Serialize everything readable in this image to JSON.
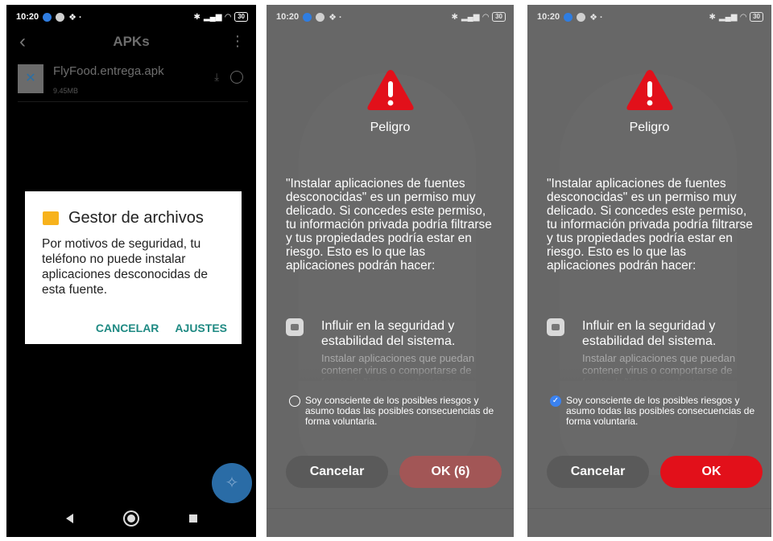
{
  "status_bar": {
    "time": "10:20",
    "battery": "30"
  },
  "screen1": {
    "app_title": "APKs",
    "file": {
      "name": "FlyFood.entrega.apk",
      "size": "9.45MB"
    },
    "dialog": {
      "title": "Gestor de archivos",
      "body": "Por motivos de seguridad, tu teléfono no puede instalar aplicaciones desconocidas de esta fuente.",
      "cancel": "CANCELAR",
      "settings": "AJUSTES"
    }
  },
  "screen2": {
    "title": "Peligro",
    "body": "\"Instalar aplicaciones de fuentes desconocidas\" es un permiso muy delicado. Si concedes este permiso, tu información privada podría filtrarse y tus propiedades podría estar en riesgo. Esto es lo que las aplicaciones podrán hacer:",
    "permission_title": "Influir en la seguridad y estabilidad del sistema.",
    "permission_desc": "Instalar aplicaciones que puedan contener virus o comportarse de forma dañina en cualquier otra",
    "consent": "Soy consciente de los posibles riesgos y asumo todas las posibles consecuencias de forma voluntaria.",
    "consent_checked": false,
    "cancel": "Cancelar",
    "ok": "OK (6)"
  },
  "screen3": {
    "title": "Peligro",
    "body": "\"Instalar aplicaciones de fuentes desconocidas\" es un permiso muy delicado. Si concedes este permiso, tu información privada podría filtrarse y tus propiedades podría estar en riesgo. Esto es lo que las aplicaciones podrán hacer:",
    "permission_title": "Influir en la seguridad y estabilidad del sistema.",
    "permission_desc": "Instalar aplicaciones que puedan contener virus o comportarse de forma dañina en cualquier otra",
    "consent": "Soy consciente de los posibles riesgos y asumo todas las posibles consecuencias de forma voluntaria.",
    "consent_checked": true,
    "cancel": "Cancelar",
    "ok": "OK"
  },
  "colors": {
    "accent": "#1f8a83",
    "danger": "#e2101a",
    "check": "#3b82f0"
  },
  "icons": [
    "back-icon",
    "more-icon",
    "apk-file-icon",
    "download-icon",
    "folder-icon",
    "cleaner-icon",
    "warning-icon",
    "system-icon",
    "checkbox-icon"
  ]
}
